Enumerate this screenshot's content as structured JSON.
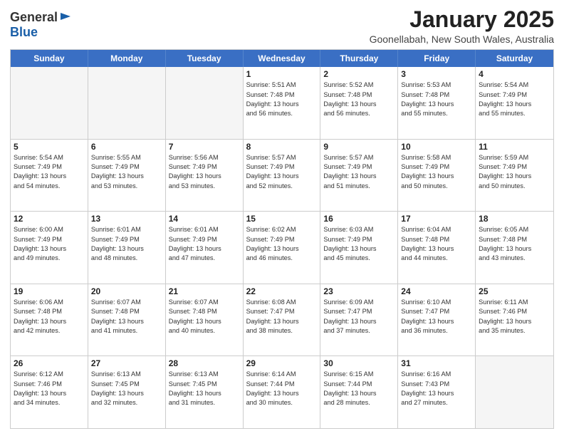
{
  "logo": {
    "general": "General",
    "blue": "Blue"
  },
  "title": "January 2025",
  "location": "Goonellabah, New South Wales, Australia",
  "header_days": [
    "Sunday",
    "Monday",
    "Tuesday",
    "Wednesday",
    "Thursday",
    "Friday",
    "Saturday"
  ],
  "rows": [
    [
      {
        "day": "",
        "empty": true
      },
      {
        "day": "",
        "empty": true
      },
      {
        "day": "",
        "empty": true
      },
      {
        "day": "1",
        "lines": [
          "Sunrise: 5:51 AM",
          "Sunset: 7:48 PM",
          "Daylight: 13 hours",
          "and 56 minutes."
        ]
      },
      {
        "day": "2",
        "lines": [
          "Sunrise: 5:52 AM",
          "Sunset: 7:48 PM",
          "Daylight: 13 hours",
          "and 56 minutes."
        ]
      },
      {
        "day": "3",
        "lines": [
          "Sunrise: 5:53 AM",
          "Sunset: 7:48 PM",
          "Daylight: 13 hours",
          "and 55 minutes."
        ]
      },
      {
        "day": "4",
        "lines": [
          "Sunrise: 5:54 AM",
          "Sunset: 7:49 PM",
          "Daylight: 13 hours",
          "and 55 minutes."
        ]
      }
    ],
    [
      {
        "day": "5",
        "lines": [
          "Sunrise: 5:54 AM",
          "Sunset: 7:49 PM",
          "Daylight: 13 hours",
          "and 54 minutes."
        ]
      },
      {
        "day": "6",
        "lines": [
          "Sunrise: 5:55 AM",
          "Sunset: 7:49 PM",
          "Daylight: 13 hours",
          "and 53 minutes."
        ]
      },
      {
        "day": "7",
        "lines": [
          "Sunrise: 5:56 AM",
          "Sunset: 7:49 PM",
          "Daylight: 13 hours",
          "and 53 minutes."
        ]
      },
      {
        "day": "8",
        "lines": [
          "Sunrise: 5:57 AM",
          "Sunset: 7:49 PM",
          "Daylight: 13 hours",
          "and 52 minutes."
        ]
      },
      {
        "day": "9",
        "lines": [
          "Sunrise: 5:57 AM",
          "Sunset: 7:49 PM",
          "Daylight: 13 hours",
          "and 51 minutes."
        ]
      },
      {
        "day": "10",
        "lines": [
          "Sunrise: 5:58 AM",
          "Sunset: 7:49 PM",
          "Daylight: 13 hours",
          "and 50 minutes."
        ]
      },
      {
        "day": "11",
        "lines": [
          "Sunrise: 5:59 AM",
          "Sunset: 7:49 PM",
          "Daylight: 13 hours",
          "and 50 minutes."
        ]
      }
    ],
    [
      {
        "day": "12",
        "lines": [
          "Sunrise: 6:00 AM",
          "Sunset: 7:49 PM",
          "Daylight: 13 hours",
          "and 49 minutes."
        ]
      },
      {
        "day": "13",
        "lines": [
          "Sunrise: 6:01 AM",
          "Sunset: 7:49 PM",
          "Daylight: 13 hours",
          "and 48 minutes."
        ]
      },
      {
        "day": "14",
        "lines": [
          "Sunrise: 6:01 AM",
          "Sunset: 7:49 PM",
          "Daylight: 13 hours",
          "and 47 minutes."
        ]
      },
      {
        "day": "15",
        "lines": [
          "Sunrise: 6:02 AM",
          "Sunset: 7:49 PM",
          "Daylight: 13 hours",
          "and 46 minutes."
        ]
      },
      {
        "day": "16",
        "lines": [
          "Sunrise: 6:03 AM",
          "Sunset: 7:49 PM",
          "Daylight: 13 hours",
          "and 45 minutes."
        ]
      },
      {
        "day": "17",
        "lines": [
          "Sunrise: 6:04 AM",
          "Sunset: 7:48 PM",
          "Daylight: 13 hours",
          "and 44 minutes."
        ]
      },
      {
        "day": "18",
        "lines": [
          "Sunrise: 6:05 AM",
          "Sunset: 7:48 PM",
          "Daylight: 13 hours",
          "and 43 minutes."
        ]
      }
    ],
    [
      {
        "day": "19",
        "lines": [
          "Sunrise: 6:06 AM",
          "Sunset: 7:48 PM",
          "Daylight: 13 hours",
          "and 42 minutes."
        ]
      },
      {
        "day": "20",
        "lines": [
          "Sunrise: 6:07 AM",
          "Sunset: 7:48 PM",
          "Daylight: 13 hours",
          "and 41 minutes."
        ]
      },
      {
        "day": "21",
        "lines": [
          "Sunrise: 6:07 AM",
          "Sunset: 7:48 PM",
          "Daylight: 13 hours",
          "and 40 minutes."
        ]
      },
      {
        "day": "22",
        "lines": [
          "Sunrise: 6:08 AM",
          "Sunset: 7:47 PM",
          "Daylight: 13 hours",
          "and 38 minutes."
        ]
      },
      {
        "day": "23",
        "lines": [
          "Sunrise: 6:09 AM",
          "Sunset: 7:47 PM",
          "Daylight: 13 hours",
          "and 37 minutes."
        ]
      },
      {
        "day": "24",
        "lines": [
          "Sunrise: 6:10 AM",
          "Sunset: 7:47 PM",
          "Daylight: 13 hours",
          "and 36 minutes."
        ]
      },
      {
        "day": "25",
        "lines": [
          "Sunrise: 6:11 AM",
          "Sunset: 7:46 PM",
          "Daylight: 13 hours",
          "and 35 minutes."
        ]
      }
    ],
    [
      {
        "day": "26",
        "lines": [
          "Sunrise: 6:12 AM",
          "Sunset: 7:46 PM",
          "Daylight: 13 hours",
          "and 34 minutes."
        ]
      },
      {
        "day": "27",
        "lines": [
          "Sunrise: 6:13 AM",
          "Sunset: 7:45 PM",
          "Daylight: 13 hours",
          "and 32 minutes."
        ]
      },
      {
        "day": "28",
        "lines": [
          "Sunrise: 6:13 AM",
          "Sunset: 7:45 PM",
          "Daylight: 13 hours",
          "and 31 minutes."
        ]
      },
      {
        "day": "29",
        "lines": [
          "Sunrise: 6:14 AM",
          "Sunset: 7:44 PM",
          "Daylight: 13 hours",
          "and 30 minutes."
        ]
      },
      {
        "day": "30",
        "lines": [
          "Sunrise: 6:15 AM",
          "Sunset: 7:44 PM",
          "Daylight: 13 hours",
          "and 28 minutes."
        ]
      },
      {
        "day": "31",
        "lines": [
          "Sunrise: 6:16 AM",
          "Sunset: 7:43 PM",
          "Daylight: 13 hours",
          "and 27 minutes."
        ]
      },
      {
        "day": "",
        "empty": true
      }
    ]
  ]
}
